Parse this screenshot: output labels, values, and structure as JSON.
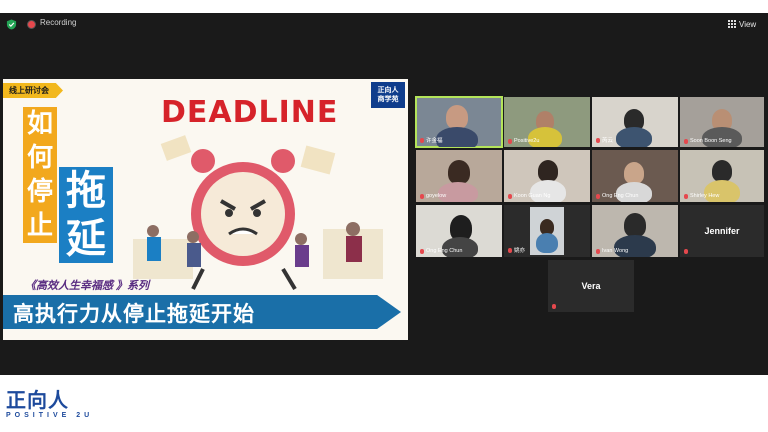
{
  "topbar": {
    "recording_label": "Recording",
    "view_label": "View",
    "security_icon": "shield-check-icon",
    "view_icon": "grid-icon"
  },
  "slide": {
    "badge": "线上研讨会",
    "brand_line1": "正向人",
    "brand_line2": "商学苑",
    "deadline": "DEADLINE",
    "chars_yellow": [
      "如",
      "何",
      "停",
      "止"
    ],
    "chars_blue": [
      "拖",
      "延"
    ],
    "series": "《高效人生幸福感 》系列",
    "banner": "高执行力从停止拖延开始"
  },
  "participants": [
    {
      "name": "许金福",
      "video": true
    },
    {
      "name": "Positive2u",
      "video": true
    },
    {
      "name": "芮云",
      "video": true
    },
    {
      "name": "Soon Boon Seng",
      "video": true
    },
    {
      "name": "goyelow",
      "video": true
    },
    {
      "name": "Koon Guan Ng",
      "video": true
    },
    {
      "name": "Ong Eng Chun",
      "video": true
    },
    {
      "name": "Shirley Hew",
      "video": true
    },
    {
      "name": "Ong Eng Chun",
      "video": true
    },
    {
      "name": "姚亦",
      "video": true
    },
    {
      "name": "Ivan Wong",
      "video": true
    },
    {
      "name": "Jennifer",
      "video": false
    },
    {
      "name": "Vera",
      "video": false
    }
  ],
  "footer": {
    "logo_cn": "正向人",
    "logo_en": "POSITIVE 2U"
  },
  "colors": {
    "active_speaker": "#b4e45a",
    "mic_muted": "#e5484d",
    "brand_blue": "#1d4a9c"
  }
}
